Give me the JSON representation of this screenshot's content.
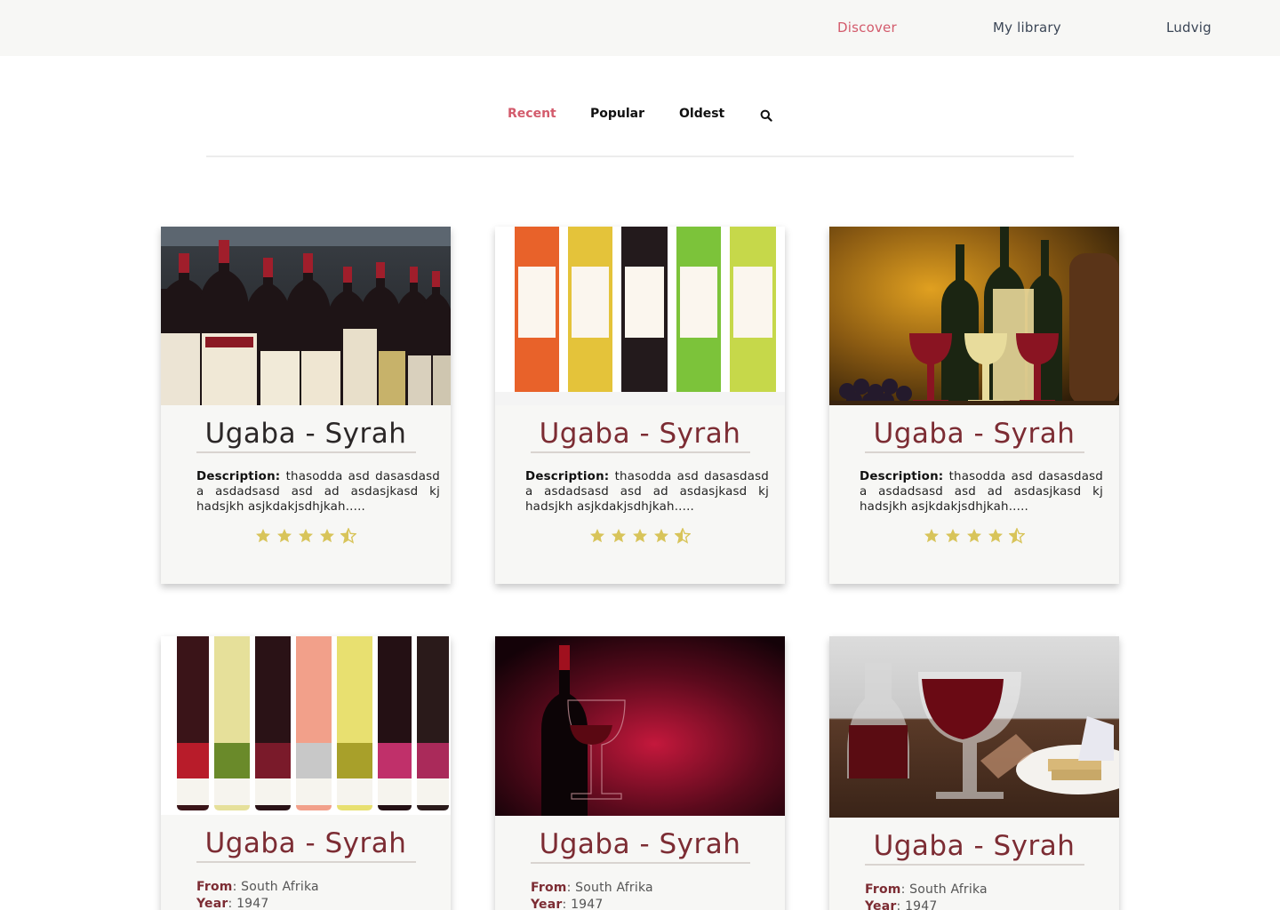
{
  "nav": {
    "discover": "Discover",
    "library": "My library",
    "user": "Ludvig"
  },
  "filters": {
    "recent": "Recent",
    "popular": "Popular",
    "oldest": "Oldest",
    "search_icon": "search-icon"
  },
  "colors": {
    "accent": "#d35b6c",
    "title": "#7c2c33",
    "star": "#d8c45a",
    "card_bg": "#f7f7f5"
  },
  "cards": [
    {
      "title": "Ugaba - Syrah",
      "desc_label": "Description:",
      "desc_text": " thasodda asd  dasasdasd a asdadsasd asd ad asdasjkasd kj hadsjkh asjkdakjsdhjkah.....",
      "rating": 4.5
    },
    {
      "title": "Ugaba - Syrah",
      "desc_label": "Description:",
      "desc_text": " thasodda asd  dasasdasd a asdadsasd asd ad asdasjkasd kj hadsjkh asjkdakjsdhjkah.....",
      "rating": 4.5
    },
    {
      "title": "Ugaba - Syrah",
      "desc_label": "Description:",
      "desc_text": " thasodda asd  dasasdasd a asdadsasd asd ad asdasjkasd kj hadsjkh asjkdakjsdhjkah.....",
      "rating": 4.5
    },
    {
      "title": "Ugaba - Syrah",
      "from_label": "From",
      "from_value": ": South Afrika",
      "year_label": "Year",
      "year_value": ": 1947"
    },
    {
      "title": "Ugaba - Syrah",
      "from_label": "From",
      "from_value": ": South Afrika",
      "year_label": "Year",
      "year_value": ": 1947"
    },
    {
      "title": "Ugaba - Syrah",
      "from_label": "From",
      "from_value": ": South Afrika",
      "year_label": "Year",
      "year_value": ": 1947"
    }
  ]
}
